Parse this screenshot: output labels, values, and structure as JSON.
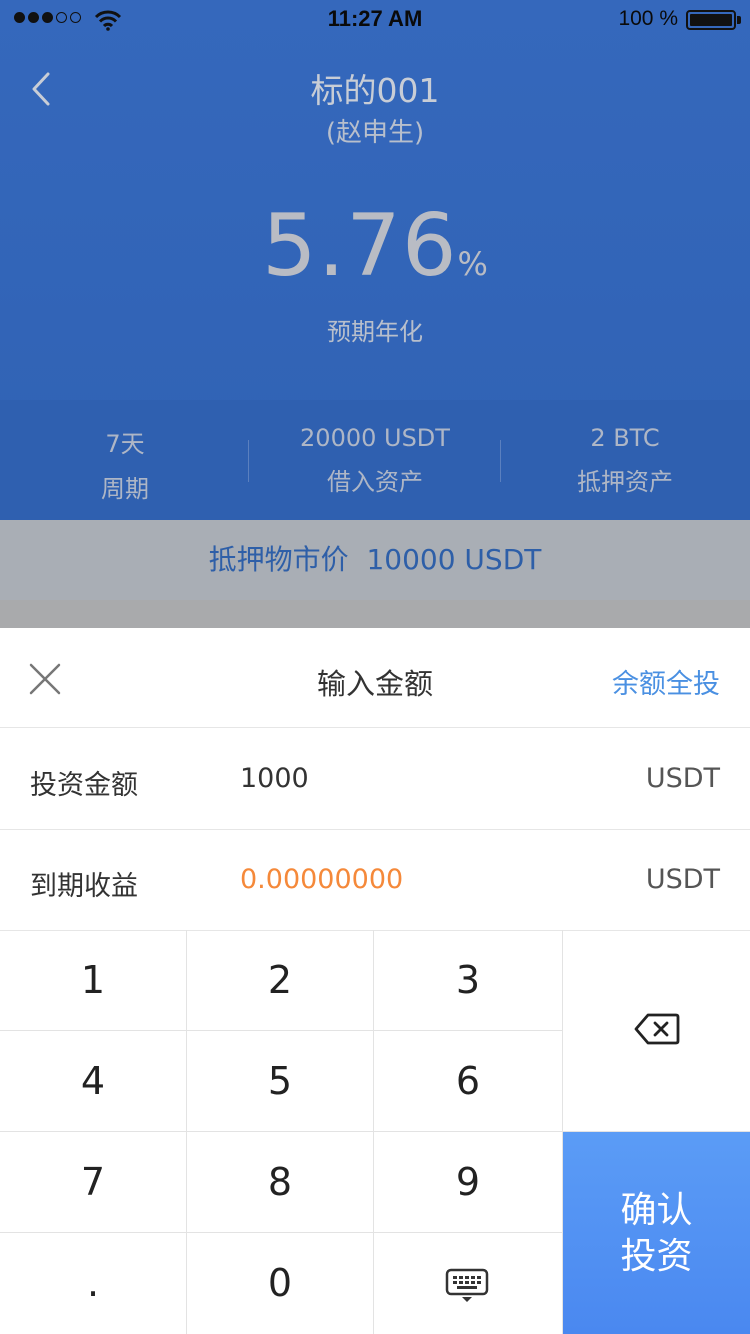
{
  "status_bar": {
    "time": "11:27 AM",
    "battery": "100 %"
  },
  "header": {
    "title": "标的001",
    "subtitle": "(赵申生)"
  },
  "rate": {
    "value": "5.76",
    "unit": "%",
    "label": "预期年化"
  },
  "stats": [
    {
      "value": "7天",
      "label": "周期"
    },
    {
      "value": "20000 USDT",
      "label": "借入资产"
    },
    {
      "value": "2 BTC",
      "label": "抵押资产"
    }
  ],
  "pledge": {
    "label": "抵押物市价",
    "value": "10000 USDT"
  },
  "sheet": {
    "title": "输入金额",
    "all_in": "余额全投",
    "rows": [
      {
        "label": "投资金额",
        "value": "1000",
        "unit": "USDT"
      },
      {
        "label": "到期收益",
        "value": "0.00000000",
        "unit": "USDT"
      }
    ]
  },
  "keypad": {
    "keys": [
      "1",
      "2",
      "3",
      "4",
      "5",
      "6",
      "7",
      "8",
      "9",
      ".",
      "0"
    ],
    "confirm_line1": "确认",
    "confirm_line2": "投资"
  },
  "colors": {
    "accent": "#4a90e2",
    "profit": "#f5893a",
    "hero_bg": "#3266b8",
    "confirm_bg": "#5191f3"
  },
  "icons": {
    "back": "chevron-left-icon",
    "close": "close-icon",
    "backspace": "backspace-icon",
    "keyboard": "keyboard-hide-icon"
  }
}
